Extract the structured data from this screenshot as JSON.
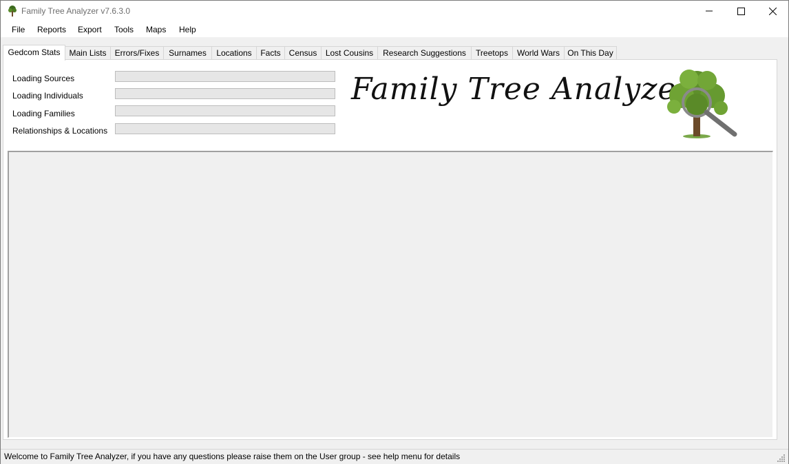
{
  "window": {
    "title": "Family Tree Analyzer v7.6.3.0"
  },
  "menu": [
    "File",
    "Reports",
    "Export",
    "Tools",
    "Maps",
    "Help"
  ],
  "tabs": [
    "Gedcom Stats",
    "Main Lists",
    "Errors/Fixes",
    "Surnames",
    "Locations",
    "Facts",
    "Census",
    "Lost Cousins",
    "Research Suggestions",
    "Treetops",
    "World Wars",
    "On This Day"
  ],
  "active_tab": "Gedcom Stats",
  "loading": [
    {
      "label": "Loading Sources",
      "progress": 0
    },
    {
      "label": "Loading Individuals",
      "progress": 0
    },
    {
      "label": "Loading Families",
      "progress": 0
    },
    {
      "label": "Relationships & Locations",
      "progress": 0
    }
  ],
  "logo": {
    "text": "Family Tree Analyzer",
    "icon": "tree-magnifier-icon"
  },
  "status": {
    "text": "Welcome to Family Tree Analyzer, if you have any questions please raise them on the User group - see help menu for details"
  },
  "colors": {
    "progress_fill": "#06b025",
    "title_text": "#6d6d6d"
  }
}
